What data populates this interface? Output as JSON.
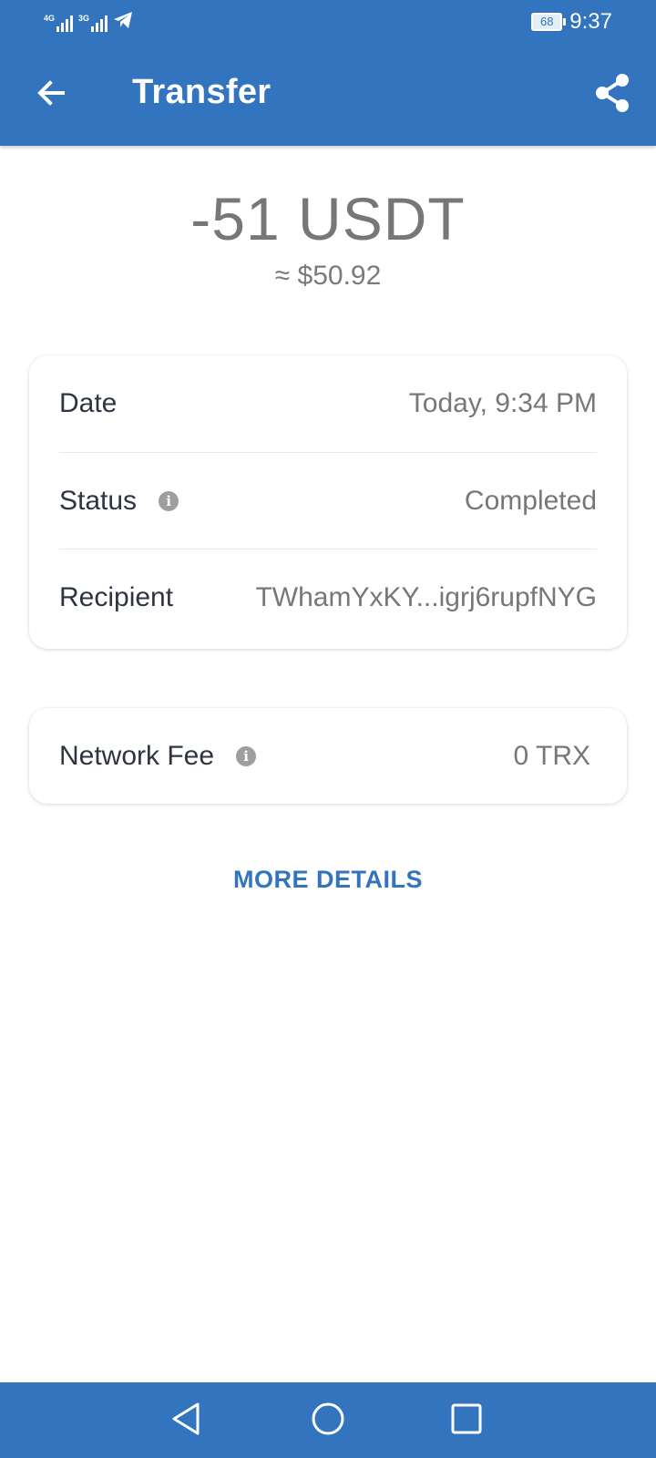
{
  "status_bar": {
    "signal1_label": "4G",
    "signal2_label": "3G",
    "battery": "68",
    "time": "9:37"
  },
  "header": {
    "title": "Transfer",
    "back_icon": "arrow-back-icon",
    "share_icon": "share-icon"
  },
  "summary": {
    "amount": "-51 USDT",
    "fiat_equivalent": "≈ $50.92"
  },
  "details": [
    {
      "label": "Date",
      "value": "Today, 9:34 PM",
      "info": false
    },
    {
      "label": "Status",
      "value": "Completed",
      "info": true
    },
    {
      "label": "Recipient",
      "value": "TWhamYxKY...igrj6rupfNYG",
      "info": false
    }
  ],
  "fee": {
    "label": "Network Fee",
    "value": "0 TRX",
    "info": true
  },
  "more_details_label": "MORE DETAILS",
  "colors": {
    "primary": "#3274bd",
    "text_dark": "#2e3440",
    "text_muted": "#777777"
  }
}
